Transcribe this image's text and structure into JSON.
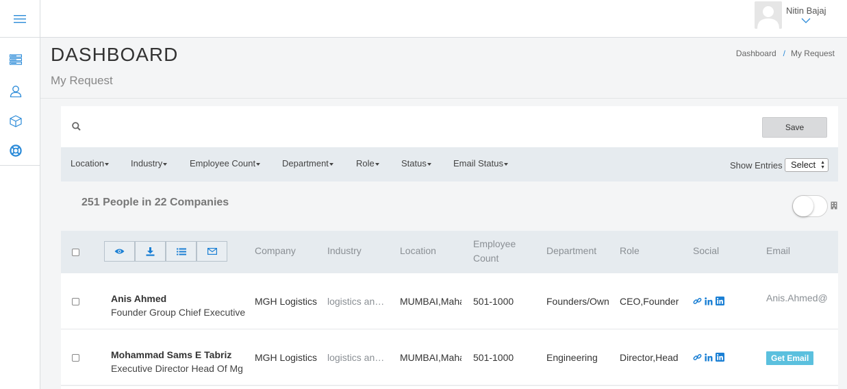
{
  "header": {
    "user_name": "Nitin Bajaj",
    "page_title": "DASHBOARD",
    "page_subtitle": "My Request",
    "breadcrumb": [
      "Dashboard",
      "My Request"
    ]
  },
  "toolbar": {
    "search_placeholder": "",
    "save_label": "Save"
  },
  "filters": [
    "Location",
    "Industry",
    "Employee Count",
    "Department",
    "Role",
    "Status",
    "Email Status"
  ],
  "show_entries": {
    "label": "Show Entries",
    "selected": "Select"
  },
  "summary": "251 People in 22 Companies",
  "table": {
    "columns": [
      "Company",
      "Industry",
      "Location",
      "Employee Count",
      "Department",
      "Role",
      "Social",
      "Email"
    ],
    "rows": [
      {
        "name": "Anis Ahmed",
        "title": "Founder Group Chief Executive",
        "company": "MGH Logistics",
        "industry": "logistics an…",
        "location": "MUMBAI,Maha",
        "employee_count": "501-1000",
        "department": "Founders/Own",
        "role": "CEO,Founder",
        "email": "Anis.Ahmed@r"
      },
      {
        "name": "Mohammad Sams E Tabriz",
        "title": "Executive Director Head Of Mg",
        "company": "MGH Logistics",
        "industry": "logistics an…",
        "location": "MUMBAI,Maha",
        "employee_count": "501-1000",
        "department": "Engineering",
        "role": "Director,Head",
        "email_button": "Get Email"
      }
    ]
  },
  "colors": {
    "accent": "#1a7fd4",
    "get_email_bg": "#5bc0de",
    "filter_bar_bg": "#e6ebef"
  }
}
